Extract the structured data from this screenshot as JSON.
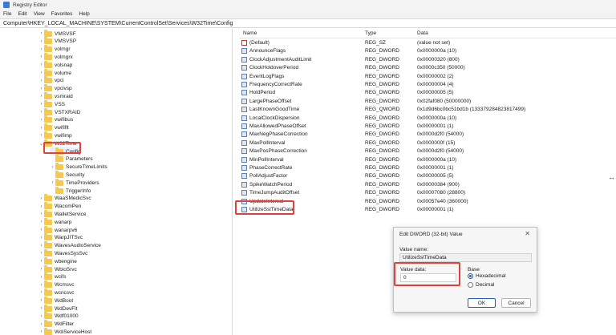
{
  "window": {
    "title": "Registry Editor"
  },
  "menu": [
    "File",
    "Edit",
    "View",
    "Favorites",
    "Help"
  ],
  "address": "Computer\\HKEY_LOCAL_MACHINE\\SYSTEM\\CurrentControlSet\\Services\\W32Time\\Config",
  "tree": [
    "VMSVSF",
    "VMSVSP",
    "volmgr",
    "volmgrx",
    "volsnap",
    "volume",
    "vpci",
    "vpcivsp",
    "vsmraid",
    "VSS",
    "VSTXRAID",
    "vwifibus",
    "vwififlt",
    "vwifimp",
    "W32Time",
    "Config",
    "Parameters",
    "SecureTimeLimits",
    "Security",
    "TimeProviders",
    "TriggerInfo",
    "WaaSMedicSvc",
    "WacomPen",
    "WalletService",
    "wanarp",
    "wanarpv6",
    "WarpJITSvc",
    "WavesAudioService",
    "WavesSysSvc",
    "wbengine",
    "WbioSrvc",
    "wcifs",
    "Wcmsvc",
    "wcncsvc",
    "WdBoot",
    "WdDevFlt",
    "Wdf01000",
    "WdFilter",
    "WdiServiceHost"
  ],
  "columns": {
    "name": "Name",
    "type": "Type",
    "data": "Data"
  },
  "values": [
    {
      "name": "(Default)",
      "type": "REG_SZ",
      "data": "(value not set)"
    },
    {
      "name": "AnnounceFlags",
      "type": "REG_DWORD",
      "data": "0x0000000a (10)"
    },
    {
      "name": "ClockAdjustmentAuditLimit",
      "type": "REG_DWORD",
      "data": "0x00000320 (800)"
    },
    {
      "name": "ClockHoldoverPeriod",
      "type": "REG_DWORD",
      "data": "0x0000c350 (50000)"
    },
    {
      "name": "EventLogFlags",
      "type": "REG_DWORD",
      "data": "0x00000002 (2)"
    },
    {
      "name": "FrequencyCorrectRate",
      "type": "REG_DWORD",
      "data": "0x00000004 (4)"
    },
    {
      "name": "HoldPeriod",
      "type": "REG_DWORD",
      "data": "0x00000005 (5)"
    },
    {
      "name": "LargePhaseOffset",
      "type": "REG_DWORD",
      "data": "0x02faf080 (50000000)"
    },
    {
      "name": "LastKnownGoodTime",
      "type": "REG_QWORD",
      "data": "0x1d9d6bc0bc51bd1b (133379284823817499)"
    },
    {
      "name": "LocalClockDispersion",
      "type": "REG_DWORD",
      "data": "0x0000000a (10)"
    },
    {
      "name": "MaxAllowedPhaseOffset",
      "type": "REG_DWORD",
      "data": "0x00000001 (1)"
    },
    {
      "name": "MaxNegPhaseCorrection",
      "type": "REG_DWORD",
      "data": "0x0000d2f0 (54000)"
    },
    {
      "name": "MaxPollInterval",
      "type": "REG_DWORD",
      "data": "0x0000000f (15)"
    },
    {
      "name": "MaxPosPhaseCorrection",
      "type": "REG_DWORD",
      "data": "0x0000d2f0 (54000)"
    },
    {
      "name": "MinPollInterval",
      "type": "REG_DWORD",
      "data": "0x0000000a (10)"
    },
    {
      "name": "PhaseCorrectRate",
      "type": "REG_DWORD",
      "data": "0x00000001 (1)"
    },
    {
      "name": "PollAdjustFactor",
      "type": "REG_DWORD",
      "data": "0x00000005 (5)"
    },
    {
      "name": "SpikeWatchPeriod",
      "type": "REG_DWORD",
      "data": "0x00000384 (900)"
    },
    {
      "name": "TimeJumpAuditOffset",
      "type": "REG_DWORD",
      "data": "0x00007080 (28800)"
    },
    {
      "name": "UpdateInterval",
      "type": "REG_DWORD",
      "data": "0x00057e40 (360000)"
    },
    {
      "name": "UtilizeSslTimeData",
      "type": "REG_DWORD",
      "data": "0x00000001 (1)"
    }
  ],
  "dialog": {
    "title": "Edit DWORD (32-bit) Value",
    "close": "✕",
    "value_name_label": "Value name:",
    "value_name": "UtilizeSslTimeData",
    "value_data_label": "Value data:",
    "value_data": "0",
    "base_label": "Base",
    "hex_label": "Hexadecimal",
    "dec_label": "Decimal",
    "base_selected": "Hexadecimal",
    "ok": "OK",
    "cancel": "Cancel"
  },
  "colors": {
    "highlight": "#e0413d",
    "folder": "#f5c94c",
    "accent": "#1f5fbf"
  }
}
